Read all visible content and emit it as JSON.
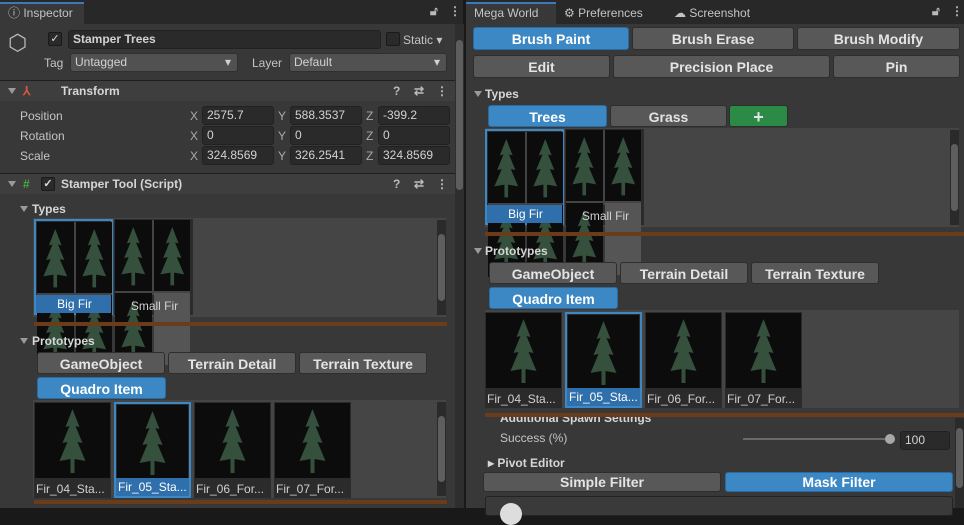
{
  "inspector": {
    "tab": "Inspector",
    "object_name": "Stamper Trees",
    "static_label": "Static",
    "tag_label": "Tag",
    "tag_value": "Untagged",
    "layer_label": "Layer",
    "layer_value": "Default",
    "transform": {
      "title": "Transform",
      "rows": [
        {
          "label": "Position",
          "x": "2575.7",
          "y": "588.3537",
          "z": "-399.2"
        },
        {
          "label": "Rotation",
          "x": "0",
          "y": "0",
          "z": "0"
        },
        {
          "label": "Scale",
          "x": "324.8569",
          "y": "326.2541",
          "z": "324.8569"
        }
      ],
      "axis": {
        "x": "X",
        "y": "Y",
        "z": "Z"
      }
    },
    "script": {
      "title": "Stamper Tool (Script)",
      "types_label": "Types",
      "types": [
        "Big Fir",
        "Small Fir"
      ],
      "prototypes_label": "Prototypes",
      "proto_tabs": [
        "GameObject",
        "Terrain Detail",
        "Terrain Texture",
        "Quadro Item"
      ],
      "prototypes": [
        "Fir_04_Sta...",
        "Fir_05_Sta...",
        "Fir_06_For...",
        "Fir_07_For..."
      ]
    }
  },
  "megaworld": {
    "tabs": [
      "Mega World",
      "Preferences",
      "Screenshot"
    ],
    "tools": [
      "Brush Paint",
      "Brush Erase",
      "Brush Modify",
      "Edit",
      "Precision Place",
      "Pin"
    ],
    "types_label": "Types",
    "type_tabs": [
      "Trees",
      "Grass",
      "+"
    ],
    "types": [
      "Big Fir",
      "Small Fir"
    ],
    "prototypes_label": "Prototypes",
    "proto_tabs": [
      "GameObject",
      "Terrain Detail",
      "Terrain Texture",
      "Quadro Item"
    ],
    "prototypes": [
      "Fir_04_Sta...",
      "Fir_05_Sta...",
      "Fir_06_For...",
      "Fir_07_For..."
    ],
    "spawn_settings": "Additional Spawn Settings",
    "success_label": "Success (%)",
    "success_value": "100",
    "success_fraction": 1.0,
    "pivot_editor": "Pivot Editor",
    "filters": [
      "Simple Filter",
      "Mask Filter"
    ]
  },
  "colors": {
    "accent": "#3c88c4",
    "add": "#2b8a45",
    "separator": "#6a3c1a"
  }
}
